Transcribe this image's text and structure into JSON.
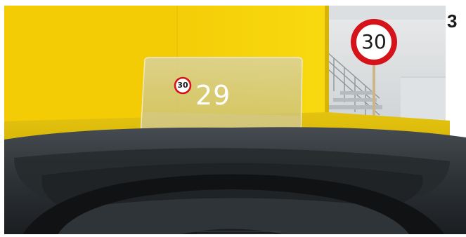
{
  "page_number": "3",
  "hud": {
    "current_speed": "29",
    "speed_limit_icon_text": "30"
  },
  "road_sign": {
    "speed_limit_text": "30"
  },
  "colors": {
    "wall_yellow": "#f6d10a",
    "dashboard": "#2a2e31",
    "sign_red": "#d4141a"
  },
  "icons": [
    "speed-limit-sign-icon"
  ]
}
